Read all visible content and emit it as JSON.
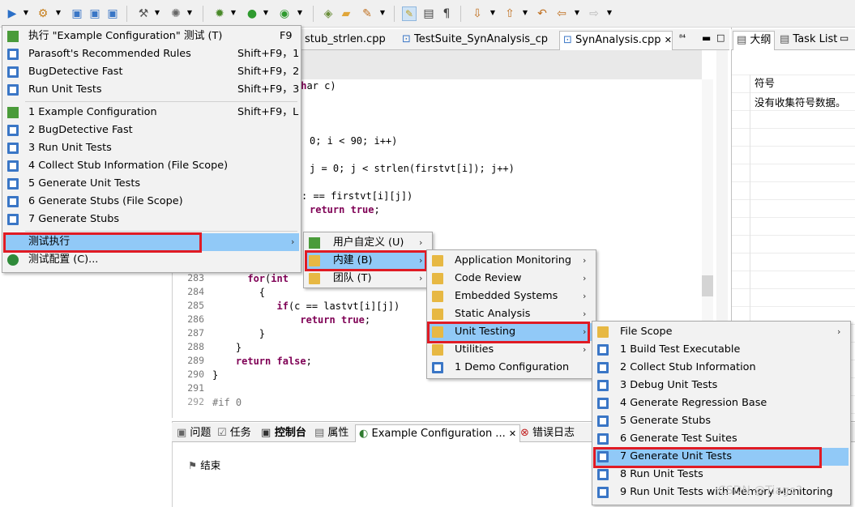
{
  "toolbar": {
    "icons": [
      "run-icon",
      "parasoft-icon",
      "test-icon",
      "test-icon",
      "test-icon",
      "build-icon",
      "web-icon",
      "debug-icon",
      "run-green-icon",
      "run-external-icon",
      "open-type-icon",
      "open-folder-icon",
      "search-icon",
      "highlight-icon",
      "block-icon",
      "paragraph-icon",
      "next-annotation-icon",
      "prev-annotation-icon",
      "last-edit-icon",
      "back-icon",
      "forward-icon"
    ]
  },
  "editor": {
    "tabs": [
      {
        "label": "stub_strlen.cpp"
      },
      {
        "label": "TestSuite_SynAnalysis_cp"
      },
      {
        "label": "SynAnalysis.cpp",
        "close": "✕"
      }
    ],
    "tab_controls": "⁸⁴",
    "code_lines": [
      {
        "ln": "",
        "text": "ar c)"
      },
      {
        "ln": "",
        "text": "0; i < 90; i++)"
      },
      {
        "ln": "",
        "text": "j = 0; j < strlen(firstvt[i]); j++)"
      },
      {
        "ln": "",
        "text": ": == firstvt[i][j])"
      },
      {
        "ln": "",
        "text": "return true;"
      },
      {
        "ln": "283",
        "text": "        for(int"
      },
      {
        "ln": "284",
        "text": "        {"
      },
      {
        "ln": "285",
        "text": "            if(c == lastvt[i][j])"
      },
      {
        "ln": "286",
        "text": "                return true;"
      },
      {
        "ln": "287",
        "text": "        }"
      },
      {
        "ln": "288",
        "text": "    }"
      },
      {
        "ln": "289",
        "text": "    return false;"
      },
      {
        "ln": "290",
        "text": "}"
      },
      {
        "ln": "291",
        "text": ""
      },
      {
        "ln": "292",
        "text": "#if 0"
      }
    ]
  },
  "right_panel": {
    "tabs": [
      {
        "label": "大纲"
      },
      {
        "label": "Task List"
      }
    ],
    "column_header": "符号",
    "empty_message": "没有收集符号数据。"
  },
  "bottom_panel": {
    "tabs": [
      {
        "label": "问题"
      },
      {
        "label": "任务"
      },
      {
        "label": "控制台"
      },
      {
        "label": "属性"
      },
      {
        "label": "Example Configuration ..."
      },
      {
        "label": "错误日志"
      }
    ],
    "console_text": "结束"
  },
  "menu_main": {
    "items": [
      {
        "label": "执行 \"Example Configuration\" 测试 (T)",
        "accel": "F9"
      },
      {
        "label": "Parasoft's Recommended Rules",
        "accel": "Shift+F9，1"
      },
      {
        "label": "BugDetective Fast",
        "accel": "Shift+F9，2"
      },
      {
        "label": "Run Unit Tests",
        "accel": "Shift+F9，3"
      },
      {
        "label": "1 Example Configuration",
        "accel": "Shift+F9，L"
      },
      {
        "label": "2 BugDetective Fast",
        "accel": ""
      },
      {
        "label": "3 Run Unit Tests",
        "accel": ""
      },
      {
        "label": "4 Collect Stub Information (File Scope)",
        "accel": ""
      },
      {
        "label": "5 Generate Unit Tests",
        "accel": ""
      },
      {
        "label": "6 Generate Stubs (File Scope)",
        "accel": ""
      },
      {
        "label": "7 Generate Stubs",
        "accel": ""
      },
      {
        "label": "测试执行",
        "accel": "",
        "submenu": true
      },
      {
        "label": "测试配置 (C)...",
        "accel": ""
      }
    ]
  },
  "menu_run": {
    "items": [
      {
        "label": "用户自定义 (U)"
      },
      {
        "label": "内建 (B)"
      },
      {
        "label": "团队 (T)"
      }
    ]
  },
  "menu_builtin": {
    "items": [
      {
        "label": "Application Monitoring"
      },
      {
        "label": "Code Review"
      },
      {
        "label": "Embedded Systems"
      },
      {
        "label": "Static Analysis"
      },
      {
        "label": "Unit Testing"
      },
      {
        "label": "Utilities"
      },
      {
        "label": "1 Demo Configuration"
      }
    ]
  },
  "menu_unit": {
    "items": [
      {
        "label": "File Scope",
        "submenu": true
      },
      {
        "label": "1 Build Test Executable"
      },
      {
        "label": "2 Collect Stub Information"
      },
      {
        "label": "3 Debug Unit Tests"
      },
      {
        "label": "4 Generate Regression Base"
      },
      {
        "label": "5 Generate Stubs"
      },
      {
        "label": "6 Generate Test Suites"
      },
      {
        "label": "7 Generate Unit Tests"
      },
      {
        "label": "8 Run Unit Tests"
      },
      {
        "label": "9 Run Unit Tests with Memory Monitoring"
      }
    ]
  },
  "watermark": "CSDN @Tiago?"
}
